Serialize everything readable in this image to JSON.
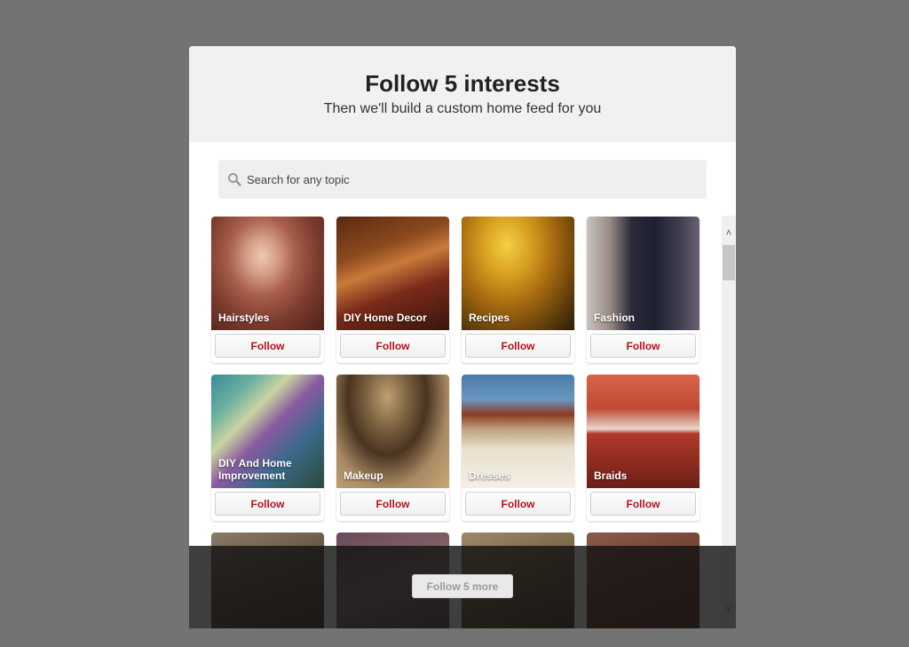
{
  "modal": {
    "title": "Follow 5 interests",
    "subtitle": "Then we'll build a custom home feed for you"
  },
  "search": {
    "placeholder": "Search for any topic",
    "icon": "search-icon"
  },
  "interests": [
    {
      "label": "Hairstyles",
      "button": "Follow"
    },
    {
      "label": "DIY Home Decor",
      "button": "Follow"
    },
    {
      "label": "Recipes",
      "button": "Follow"
    },
    {
      "label": "Fashion",
      "button": "Follow"
    },
    {
      "label": "DIY And Home Improvement",
      "button": "Follow"
    },
    {
      "label": "Makeup",
      "button": "Follow"
    },
    {
      "label": "Dresses",
      "button": "Follow"
    },
    {
      "label": "Braids",
      "button": "Follow"
    }
  ],
  "footer": {
    "button": "Follow 5 more"
  },
  "colors": {
    "backdrop": "#737373",
    "accent": "#b5121b",
    "header_bg": "#f1f1f1"
  }
}
